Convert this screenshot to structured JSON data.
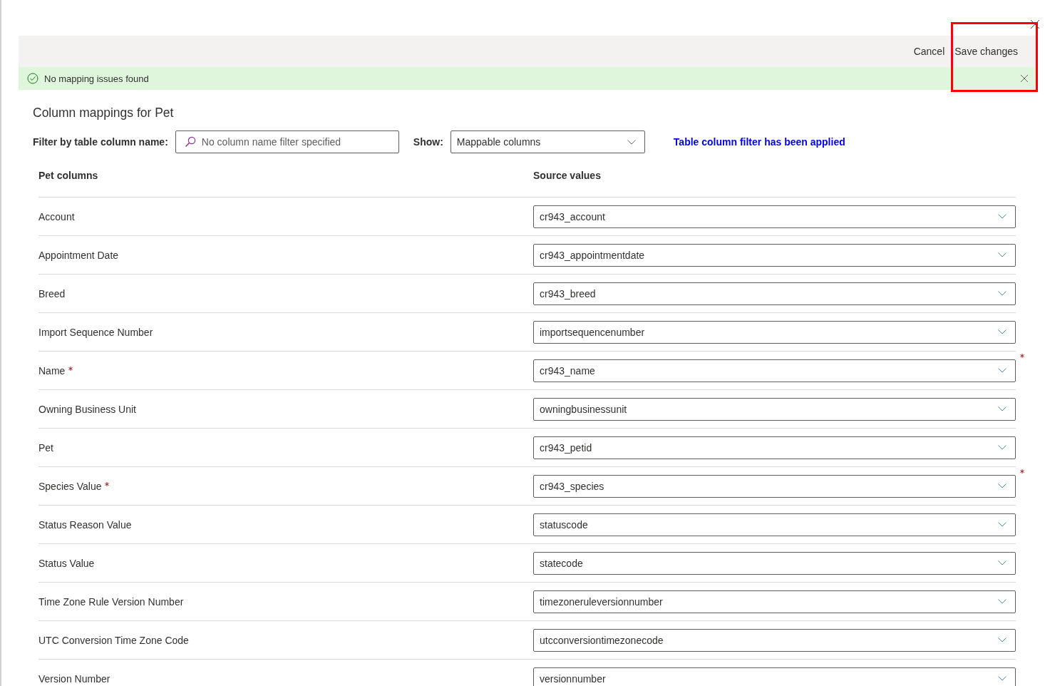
{
  "toolbar": {
    "cancel": "Cancel",
    "save": "Save changes",
    "highlighted": true
  },
  "notice": {
    "text": "No mapping issues found"
  },
  "title": "Column mappings for Pet",
  "filter": {
    "label": "Filter by table column name:",
    "placeholder": "No column name filter specified",
    "show_label": "Show:",
    "show_value": "Mappable columns",
    "status": "Table column filter has been applied"
  },
  "table": {
    "columns": [
      "Pet columns",
      "Source values"
    ],
    "rows": [
      {
        "name": "Account",
        "value": "cr943_account",
        "required": false
      },
      {
        "name": "Appointment Date",
        "value": "cr943_appointmentdate",
        "required": false
      },
      {
        "name": "Breed",
        "value": "cr943_breed",
        "required": false
      },
      {
        "name": "Import Sequence Number",
        "value": "importsequencenumber",
        "required": false
      },
      {
        "name": "Name",
        "value": "cr943_name",
        "required": true
      },
      {
        "name": "Owning Business Unit",
        "value": "owningbusinessunit",
        "required": false
      },
      {
        "name": "Pet",
        "value": "cr943_petid",
        "required": false
      },
      {
        "name": "Species Value",
        "value": "cr943_species",
        "required": true
      },
      {
        "name": "Status Reason Value",
        "value": "statuscode",
        "required": false
      },
      {
        "name": "Status Value",
        "value": "statecode",
        "required": false
      },
      {
        "name": "Time Zone Rule Version Number",
        "value": "timezoneruleversionnumber",
        "required": false
      },
      {
        "name": "UTC Conversion Time Zone Code",
        "value": "utcconversiontimezonecode",
        "required": false
      },
      {
        "name": "Version Number",
        "value": "versionnumber",
        "required": false
      }
    ]
  }
}
